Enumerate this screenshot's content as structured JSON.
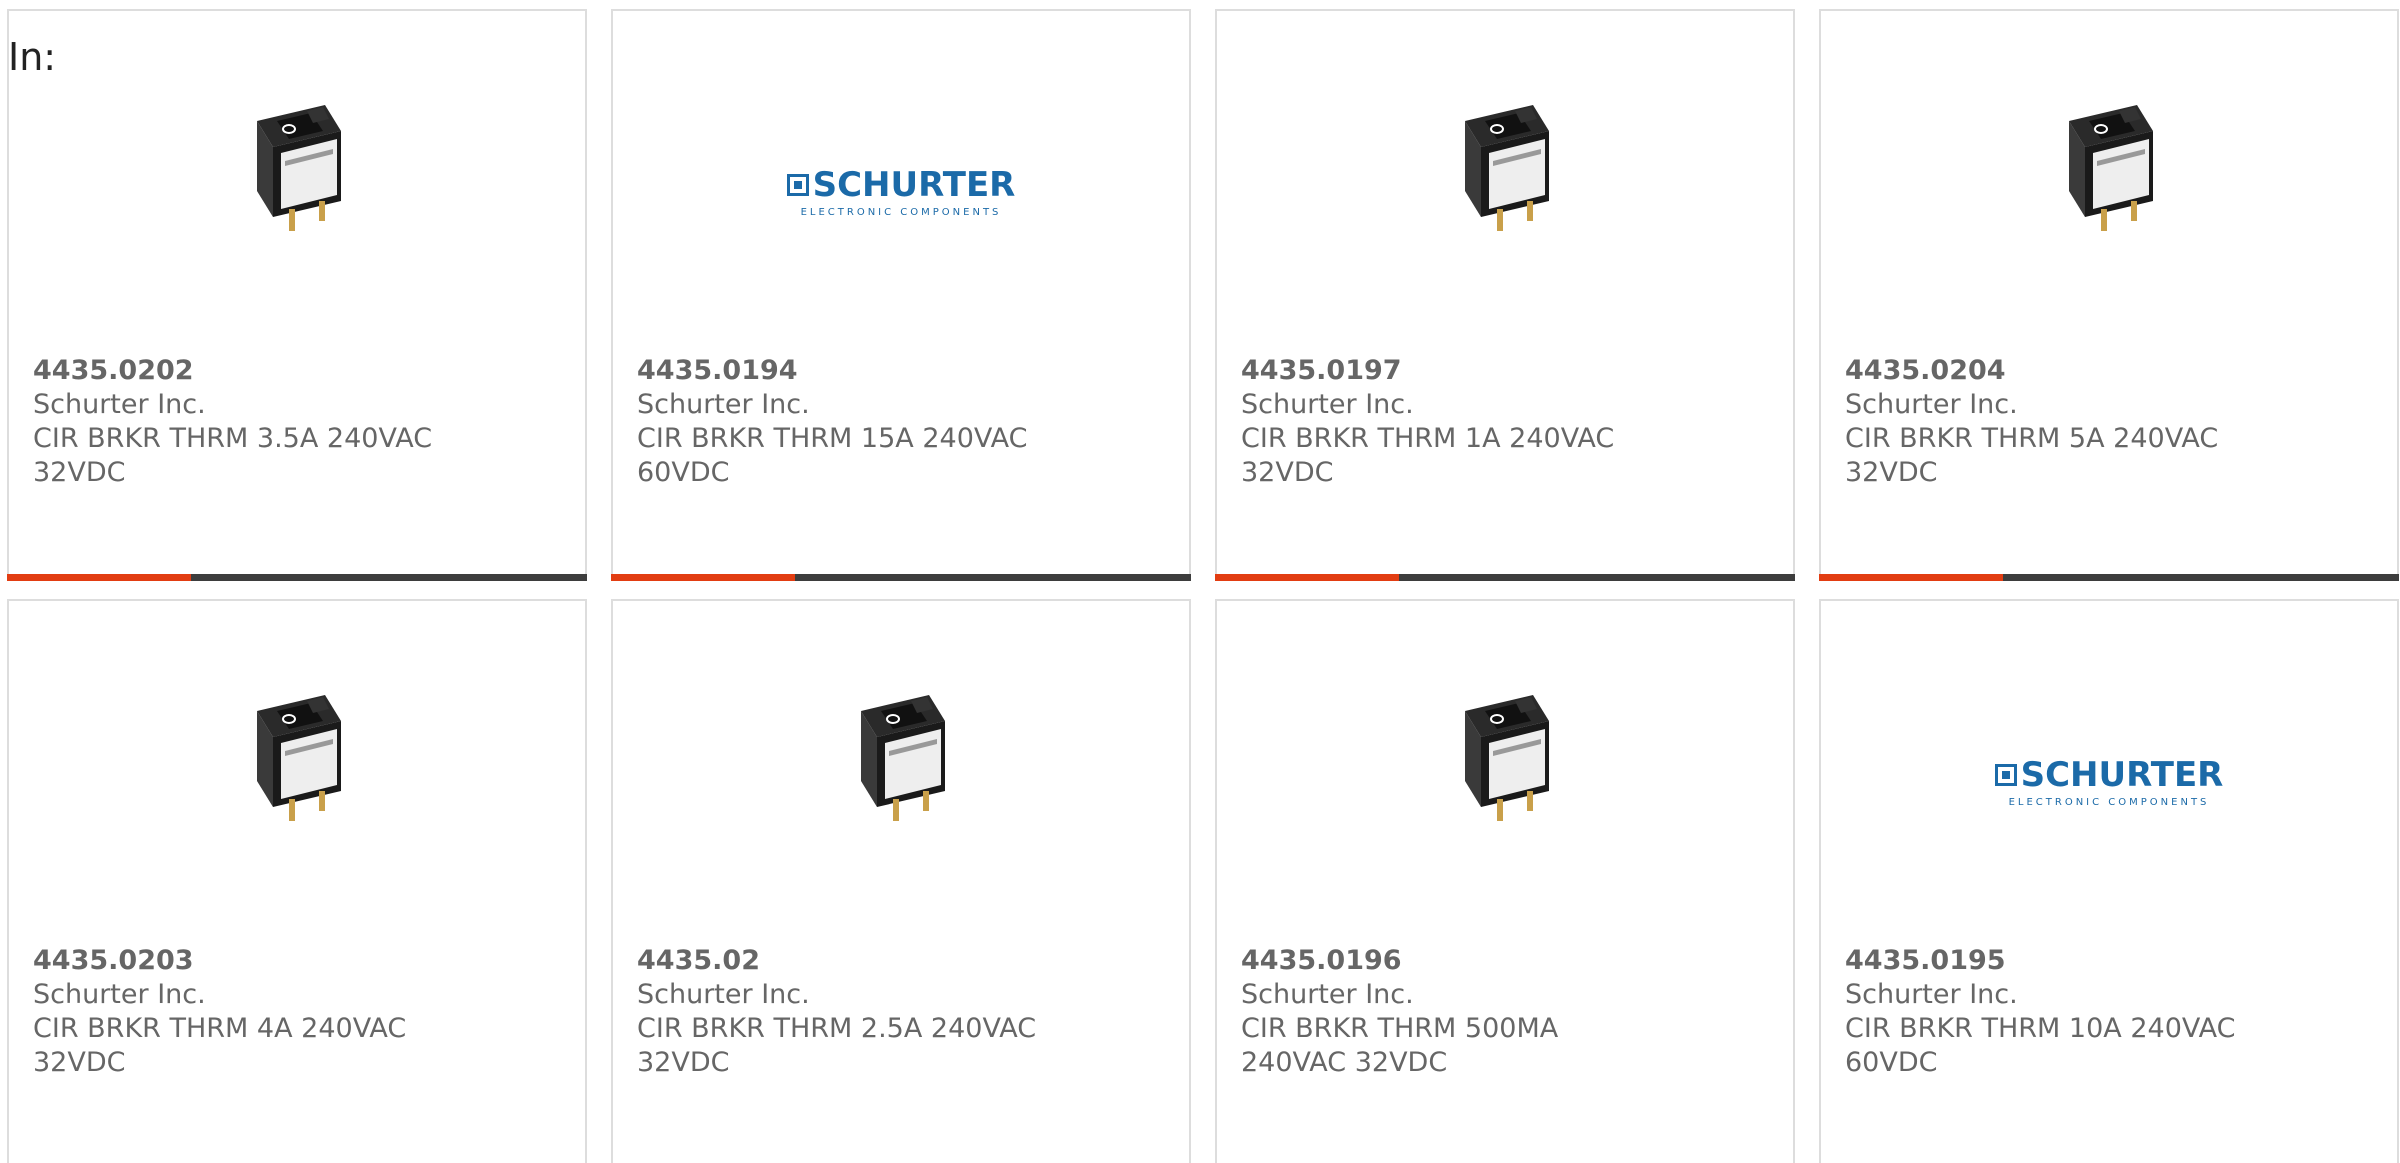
{
  "filter_label": "In:",
  "colors": {
    "accent": "#e23d12",
    "bar": "#3d3d3d",
    "logo_blue": "#1b6aa8",
    "text": "#666666"
  },
  "logo": {
    "name": "SCHURTER",
    "tagline": "ELECTRONIC COMPONENTS"
  },
  "products": [
    {
      "part_number": "4435.0202",
      "manufacturer": "Schurter Inc.",
      "description": "CIR BRKR THRM 3.5A 240VAC 32VDC",
      "image": "breaker-switch-icon"
    },
    {
      "part_number": "4435.0194",
      "manufacturer": "Schurter Inc.",
      "description": "CIR BRKR THRM 15A 240VAC 60VDC",
      "image": "schurter-logo"
    },
    {
      "part_number": "4435.0197",
      "manufacturer": "Schurter Inc.",
      "description": "CIR BRKR THRM 1A 240VAC 32VDC",
      "image": "breaker-switch-icon"
    },
    {
      "part_number": "4435.0204",
      "manufacturer": "Schurter Inc.",
      "description": "CIR BRKR THRM 5A 240VAC 32VDC",
      "image": "breaker-switch-icon"
    },
    {
      "part_number": "4435.0203",
      "manufacturer": "Schurter Inc.",
      "description": "CIR BRKR THRM 4A 240VAC 32VDC",
      "image": "breaker-switch-icon"
    },
    {
      "part_number": "4435.02",
      "manufacturer": "Schurter Inc.",
      "description": "CIR BRKR THRM 2.5A 240VAC 32VDC",
      "image": "breaker-switch-icon"
    },
    {
      "part_number": "4435.0196",
      "manufacturer": "Schurter Inc.",
      "description": "CIR BRKR THRM 500MA 240VAC 32VDC",
      "image": "breaker-switch-icon"
    },
    {
      "part_number": "4435.0195",
      "manufacturer": "Schurter Inc.",
      "description": "CIR BRKR THRM 10A 240VAC 60VDC",
      "image": "schurter-logo"
    }
  ]
}
